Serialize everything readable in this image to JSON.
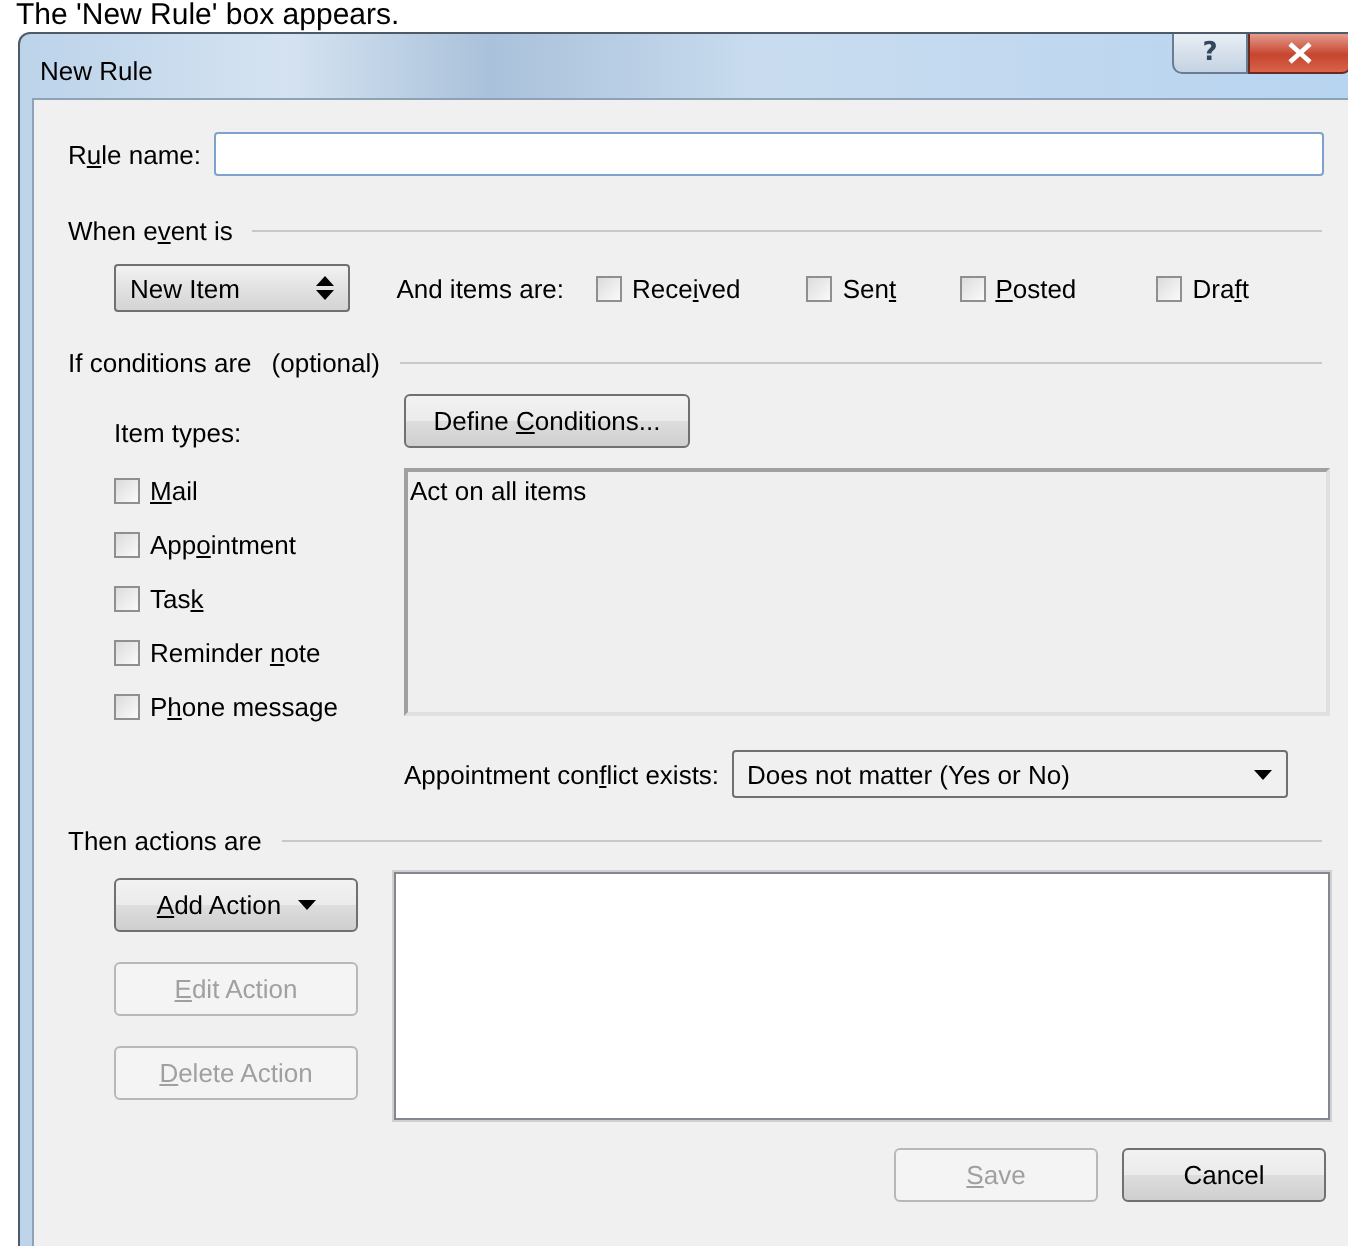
{
  "caption": "The 'New Rule' box appears.",
  "window": {
    "title": "New Rule",
    "help_label": "?"
  },
  "rule_name": {
    "label": {
      "before": "R",
      "key": "u",
      "after": "le name:"
    }
  },
  "event_section": {
    "heading": {
      "before": "When e",
      "key": "v",
      "after": "ent is"
    },
    "event_select": {
      "value": "New Item"
    },
    "items_label": "And items are:",
    "item_states": [
      {
        "label": {
          "before": "Rece",
          "key": "i",
          "after": "ved"
        },
        "checked": false
      },
      {
        "label": {
          "before": "Sen",
          "key": "t"
        },
        "checked": false
      },
      {
        "label": {
          "key": "P",
          "after": "osted"
        },
        "checked": false
      },
      {
        "label": {
          "before": "Dra",
          "key": "f",
          "after": "t"
        },
        "checked": false
      }
    ]
  },
  "conditions_section": {
    "heading": "If conditions are",
    "note": "(optional)",
    "define_button": {
      "before": "Define ",
      "key": "C",
      "after": "onditions..."
    },
    "item_types_label": "Item types:",
    "item_types": [
      {
        "label": {
          "key": "M",
          "after": "ail"
        },
        "checked": false
      },
      {
        "label": {
          "before": "App",
          "key": "o",
          "after": "intment"
        },
        "checked": false
      },
      {
        "label": {
          "before": "Tas",
          "key": "k"
        },
        "checked": false
      },
      {
        "label": {
          "before": "Reminder ",
          "key": "n",
          "after": "ote"
        },
        "checked": false
      },
      {
        "label": {
          "before": "P",
          "key": "h",
          "after": "one message"
        },
        "checked": false
      }
    ],
    "conditions_text": "Act on all items",
    "conflict_label": {
      "before": "Appointment con",
      "key": "f",
      "after": "lict exists:"
    },
    "conflict_select": {
      "value": "Does not matter (Yes or No)"
    }
  },
  "actions_section": {
    "heading": "Then actions are",
    "buttons": [
      {
        "label": {
          "key": "A",
          "after": "dd Action"
        },
        "disabled": false,
        "dropdown": true
      },
      {
        "label": {
          "key": "E",
          "after": "dit Action"
        },
        "disabled": true,
        "dropdown": false
      },
      {
        "label": {
          "key": "D",
          "after": "elete Action"
        },
        "disabled": true,
        "dropdown": false
      }
    ]
  },
  "footer_buttons": [
    {
      "label": {
        "key": "S",
        "after": "ave"
      },
      "disabled": true
    },
    {
      "label": {
        "before": "Cancel"
      },
      "disabled": false
    }
  ]
}
